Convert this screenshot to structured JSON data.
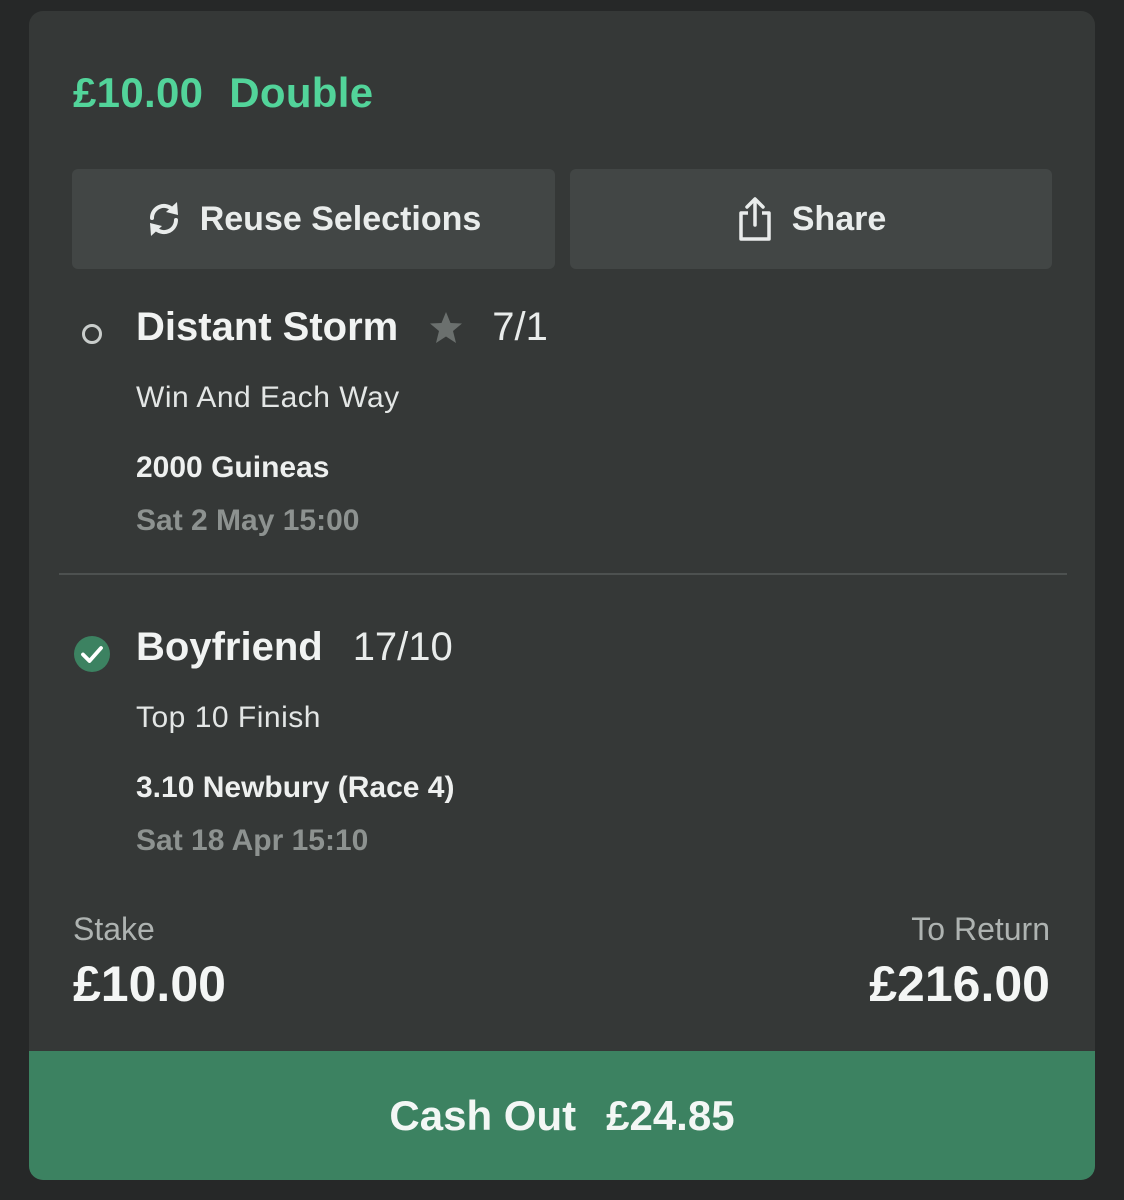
{
  "bet": {
    "stake_display": "£10.00",
    "type": "Double"
  },
  "actions": {
    "reuse_label": "Reuse Selections",
    "share_label": "Share"
  },
  "legs": [
    {
      "status": "open",
      "status_icon": "open-circle-icon",
      "runner": "Distant Storm",
      "favourite_icon": "star-icon",
      "odds": "7/1",
      "market": "Win And Each Way",
      "event": "2000 Guineas",
      "time": "Sat 2 May 15:00"
    },
    {
      "status": "won",
      "status_icon": "check-circle-icon",
      "runner": "Boyfriend",
      "odds": "17/10",
      "market": "Top 10 Finish",
      "event": "3.10 Newbury (Race 4)",
      "time": "Sat 18 Apr 15:10"
    }
  ],
  "summary": {
    "stake_label": "Stake",
    "stake_value": "£10.00",
    "return_label": "To Return",
    "return_value": "£216.00"
  },
  "cashout": {
    "label": "Cash Out",
    "amount": "£24.85"
  },
  "colors": {
    "background": "#262828",
    "card": "#353837",
    "button": "#424645",
    "accent_green": "#52d49a",
    "cashout_green": "#3c8261",
    "won_icon": "#3c8261"
  }
}
